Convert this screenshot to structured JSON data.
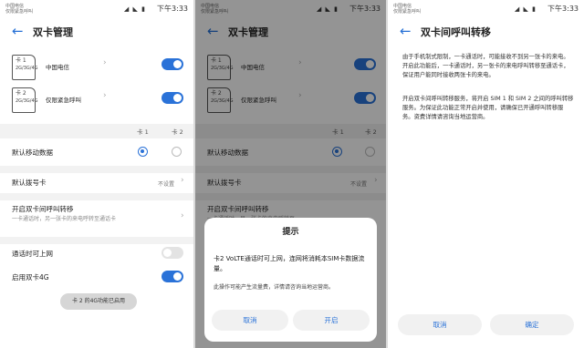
{
  "status": {
    "carrier": "中国电信",
    "carrier_sub": "仅限紧急呼叫",
    "icons": "◢ ◣ ▮",
    "time": "下午3:33"
  },
  "screen1": {
    "title": "双卡管理",
    "sim1": {
      "tag": "卡 1",
      "type": "2G/3G/4G",
      "name": "中国电信"
    },
    "sim2": {
      "tag": "卡 2",
      "type": "2G/3G/4G",
      "name": "仅限紧急呼叫"
    },
    "col1": "卡 1",
    "col2": "卡 2",
    "default_data": "默认移动数据",
    "default_dial": "默认拨号卡",
    "default_dial_value": "不设置",
    "forward_title": "开启双卡间呼叫转移",
    "forward_sub": "一卡通话时，另一张卡的来电呼转至通话卡",
    "call_online": "通话时可上网",
    "enable_4g": "启用双卡4G",
    "toast": "卡 2 的4G功能已启用"
  },
  "dialog": {
    "title": "提示",
    "message": "卡2 VoLTE通话时可上网，连网将消耗本SIM卡数据流量。",
    "note": "此操作可能产生流量费，详情请咨询当地运营商。",
    "cancel": "取消",
    "confirm": "开启",
    "bg_sub": "一卡通话时，另一张卡的来电呼转至"
  },
  "screen3": {
    "title": "双卡间呼叫转移",
    "para1": "由于手机制式限制，一卡通话时，可能接收不到另一张卡的来电。开启此功能后，一卡通话时，另一张卡的来电呼叫转移至通话卡，保证用户能同时接收两张卡的来电。",
    "para2": "开启双卡间呼叫转移服务，将开启 SIM 1 和 SIM 2 之间的呼叫转移服务。为保证此功能正常开启并使用，请确保已开通呼叫转移服务。资费详情请咨询当地运营商。",
    "cancel": "取消",
    "confirm": "确定"
  },
  "colors": {
    "accent": "#2a72d8",
    "toggle_off": "#e3e3e3"
  }
}
